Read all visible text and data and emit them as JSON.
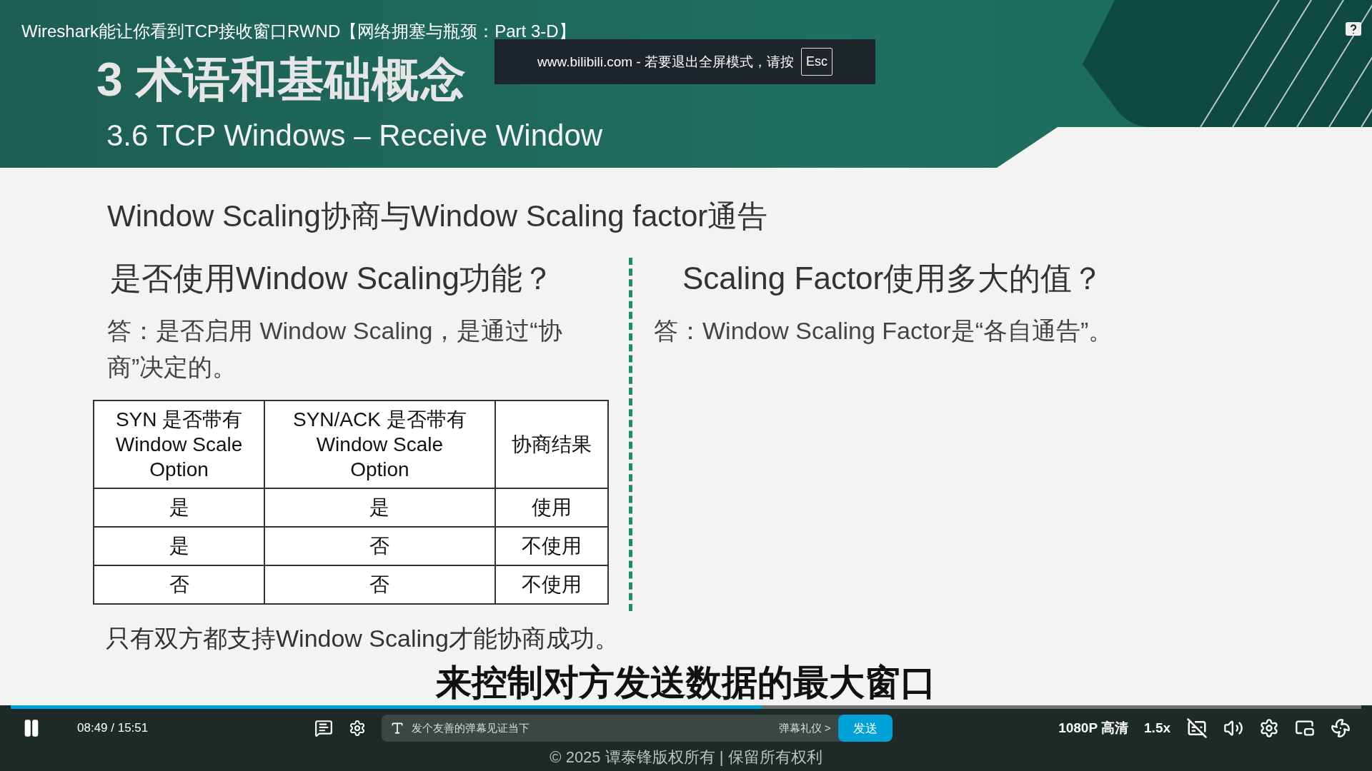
{
  "video_title": "Wireshark能让你看到TCP接收窗口RWND【网络拥塞与瓶颈：Part 3-D】",
  "fullscreen_notice": {
    "text": "www.bilibili.com - 若要退出全屏模式，请按",
    "key": "Esc"
  },
  "slide": {
    "chapter": "3 术语和基础概念",
    "section": "3.6 TCP Windows – Receive Window",
    "heading": "Window Scaling协商与Window Scaling factor通告",
    "left": {
      "question": "是否使用Window Scaling功能？",
      "answer": "答：是否启用 Window Scaling，是通过“协商”决定的。"
    },
    "right": {
      "question": "Scaling Factor使用多大的值？",
      "answer": "答：Window Scaling Factor是“各自通告”。"
    },
    "table": {
      "columns": [
        "SYN 是否带有\nWindow Scale\nOption",
        "SYN/ACK 是否带有\nWindow Scale\nOption",
        "协商结果"
      ],
      "rows": [
        [
          "是",
          "是",
          "使用"
        ],
        [
          "是",
          "否",
          "不使用"
        ],
        [
          "否",
          "否",
          "不使用"
        ]
      ]
    },
    "note": "只有双方都支持Window Scaling才能协商成功。",
    "footer": "© 2025 谭泰锋版权所有 | 保留所有权利"
  },
  "subtitle": "来控制对方发送数据的最大窗口",
  "player": {
    "level": 0.556,
    "time": "08:49 / 15:51",
    "danmaku_placeholder": "发个友善的弹幕见证当下",
    "danmaku_etiquette": "弹幕礼仪 >",
    "send": "发送",
    "quality": "1080P 高清",
    "speed": "1.5x"
  }
}
